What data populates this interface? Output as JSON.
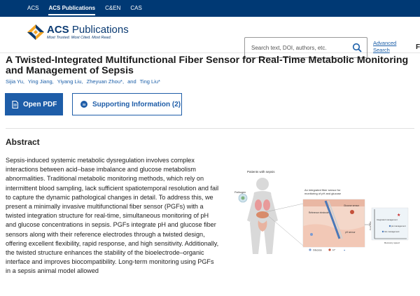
{
  "topnav": {
    "items": [
      {
        "label": "ACS",
        "active": false
      },
      {
        "label": "ACS Publications",
        "active": true
      },
      {
        "label": "C&EN",
        "active": false
      },
      {
        "label": "CAS",
        "active": false
      }
    ]
  },
  "header": {
    "logo_prefix": "ACS",
    "logo_suffix": "Publications",
    "tagline": "Most Trusted. Most Cited. Most Read.",
    "search_placeholder": "Search text, DOI, authors, etc.",
    "advanced_search_line1": "Advanced",
    "advanced_search_line2": "Search"
  },
  "article": {
    "title": "A Twisted-Integrated Multifunctional Fiber Sensor for Real-Time Metabolic Monitoring and Management of Sepsis",
    "authors": [
      "Sijia Yu,",
      "Ying Jiang,",
      "Yiyang Liu,",
      "Zheyuan Zhou*,",
      "and",
      "Ting Liu*"
    ],
    "open_pdf_label": "Open PDF",
    "supporting_info_label": "Supporting Information (2)",
    "si_badge": "SI"
  },
  "abstract": {
    "heading": "Abstract",
    "text": "Sepsis-induced systemic metabolic dysregulation involves complex interactions between acid–base imbalance and glucose metabolism abnormalities. Traditional metabolic monitoring methods, which rely on intermittent blood sampling, lack sufficient spatiotemporal resolution and fail to capture the dynamic pathological changes in detail. To address this, we present a minimally invasive multifunctional fiber sensor (PGFs) with a twisted integration structure for real-time, simultaneous monitoring of pH and glucose concentrations in sepsis. PGFs integrate pH and glucose fiber sensors along with their reference electrodes through a twisted design, offering excellent flexibility, rapid response, and high sensitivity. Additionally, the twisted structure enhances the stability of the bioelectrode–organic interface and improves biocompatibility. Long-term monitoring using PGFs in a sepsis animal model allowed"
  },
  "toc_graphic": {
    "patients_label": "Patients with sepsis",
    "pathogen_label": "Pathogen",
    "fiber_label_1": "An integrated fiber sensor for",
    "fiber_label_2": "monitoring of pH and glucose",
    "reference_label": "Reference electrode",
    "glucose_sensor_label": "Glucose sensor",
    "ph_sensor_label": "pH sensor",
    "legend_glucose": "Glucose",
    "legend_h": "H⁺",
    "legend_dot": "●",
    "chart_y_label": "Cure rate",
    "chart_x_label": "Recovery speed",
    "integrated_mgmt": "Integrated management",
    "ph_mgmt": "pH management",
    "glu_mgmt": "Glu management"
  }
}
